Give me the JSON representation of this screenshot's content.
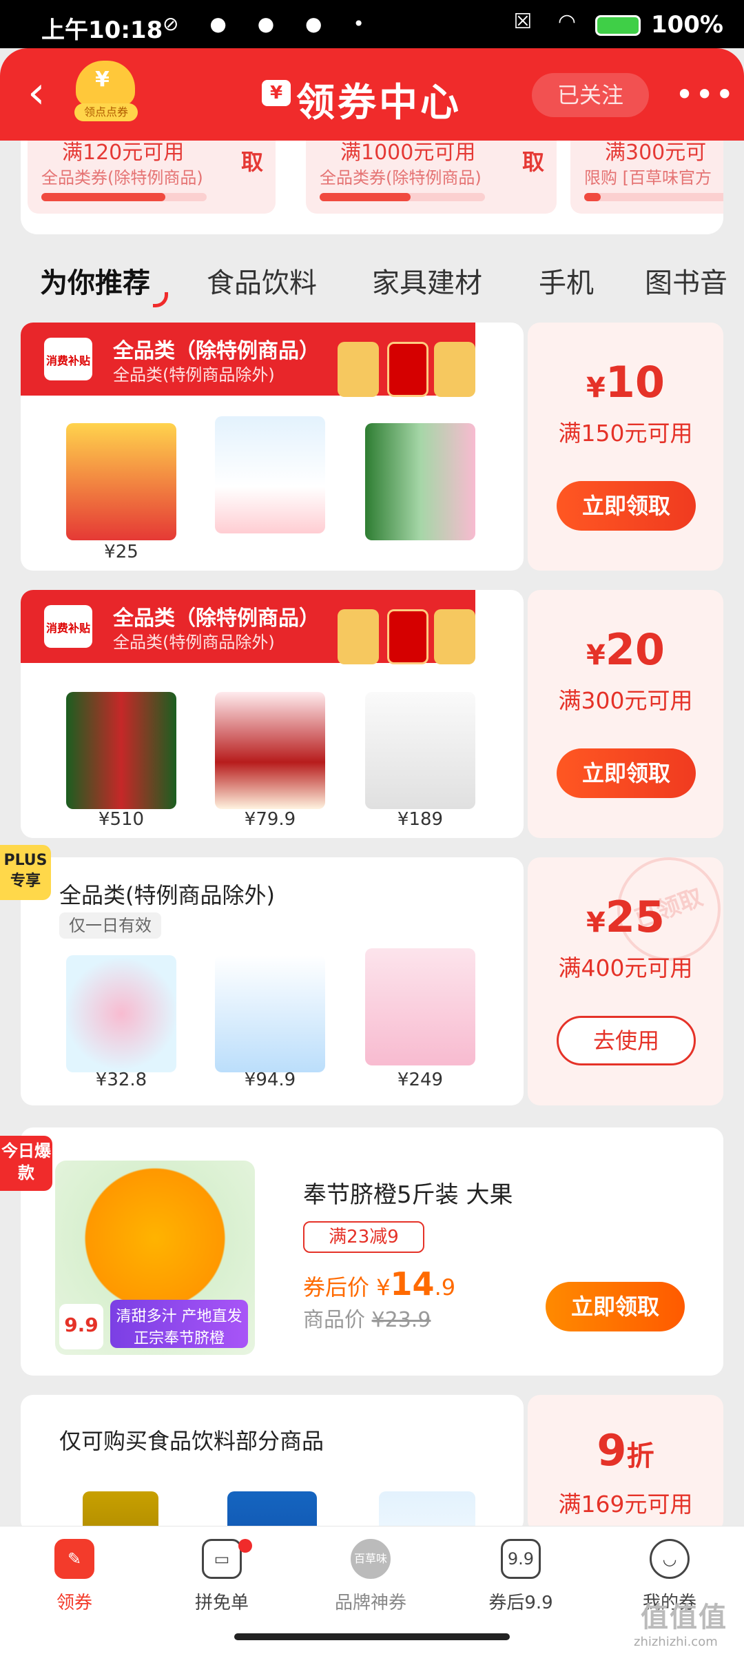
{
  "status_bar": {
    "time": "上午10:18",
    "battery": "100%"
  },
  "header": {
    "title": "领券中心",
    "follow_label": "已关注",
    "mascot_label": "领点点券",
    "title_icon": "¥"
  },
  "top_coupons": [
    {
      "amount": "满120元可用",
      "scope": "全品类券(除特例商品)",
      "action": "取",
      "progress": 0.75
    },
    {
      "amount": "满1000元可用",
      "scope": "全品类券(除特例商品)",
      "action": "取",
      "progress": 0.55
    },
    {
      "amount": "满300元可",
      "scope": "限购 [百草味官方",
      "action": "",
      "progress": 0.1
    }
  ],
  "tabs": [
    "为你推荐",
    "食品饮料",
    "家具建材",
    "手机",
    "图书音"
  ],
  "coupons": [
    {
      "badge": "消费补贴",
      "title": "全品类（除特例商品）",
      "subtitle": "全品类(特例商品除外)",
      "prices": [
        "¥25",
        "",
        ""
      ],
      "yen": "¥",
      "value": "10",
      "condition": "满150元可用",
      "button": "立即领取"
    },
    {
      "badge": "消费补贴",
      "title": "全品类（除特例商品）",
      "subtitle": "全品类(特例商品除外)",
      "prices": [
        "¥510",
        "¥79.9",
        "¥189"
      ],
      "yen": "¥",
      "value": "20",
      "condition": "满300元可用",
      "button": "立即领取"
    },
    {
      "plus_tag": "PLUS专享",
      "title": "全品类(特例商品除外)",
      "subtitle": "仅一日有效",
      "prices": [
        "¥32.8",
        "¥94.9",
        "¥249"
      ],
      "yen": "¥",
      "value": "25",
      "condition": "满400元可用",
      "button": "去使用",
      "stamp": "已领取"
    }
  ],
  "deal": {
    "tag": "今日爆款",
    "title": "奉节脐橙5斤装 大果",
    "discount": "满23减9",
    "after_label": "券后价",
    "after_price_yen": "¥",
    "after_price": "14",
    "after_price_decimal": ".9",
    "orig_label": "商品价",
    "orig_price": "¥23.9",
    "button": "立即领取",
    "img_ribbon": "清甜多汁 产地直发 正宗奉节脐橙",
    "img_price": "9.9"
  },
  "last_coupon": {
    "title": "仅可购买食品饮料部分商品",
    "value": "9",
    "unit": "折",
    "condition": "满169元可用"
  },
  "bottom_nav": [
    {
      "label": "领券",
      "icon": "coupon-icon"
    },
    {
      "label": "拼免单",
      "icon": "ticket-icon"
    },
    {
      "label": "品牌神券",
      "icon": "brand-icon",
      "icon_text": "百草味"
    },
    {
      "label": "券后9.9",
      "icon": "price-tag-icon",
      "icon_text": "9.9"
    },
    {
      "label": "我的券",
      "icon": "smile-icon"
    }
  ],
  "watermark": {
    "text": "值值值",
    "site": "zhizhizhi.com"
  },
  "colors": {
    "primary": "#f02b2b",
    "accent": "#ff5722"
  }
}
